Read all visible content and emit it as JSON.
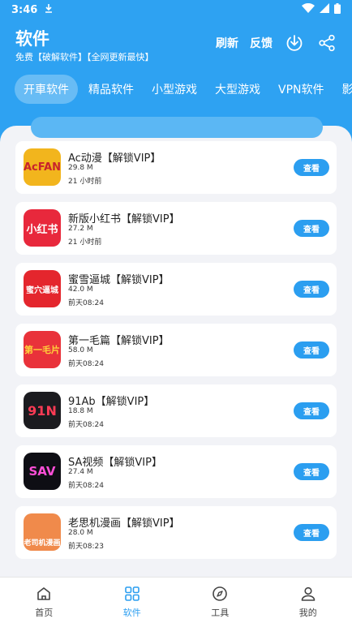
{
  "status": {
    "time": "3:46"
  },
  "header": {
    "title": "软件",
    "subtitle": "免费【破解软件】【全网更新最快】",
    "refresh_label": "刷新",
    "feedback_label": "反馈"
  },
  "tabs": [
    {
      "label": "开車软件",
      "active": true
    },
    {
      "label": "精品软件"
    },
    {
      "label": "小型游戏"
    },
    {
      "label": "大型游戏"
    },
    {
      "label": "VPN软件"
    },
    {
      "label": "影视软件"
    }
  ],
  "apps": [
    {
      "name": "Ac动漫【解锁VIP】",
      "size": "29.8 M",
      "time": "21 小时前",
      "icon_text": "AcFAN",
      "icon_color": "#f2b51d",
      "button": "查看"
    },
    {
      "name": "新版小红书【解锁VIP】",
      "size": "27.2 M",
      "time": "21 小时前",
      "icon_text": "小红书",
      "icon_color": "#e8283c",
      "button": "查看"
    },
    {
      "name": "蜜雪逼城【解锁VIP】",
      "size": "42.0 M",
      "time": "前天08:24",
      "icon_text": "蜜穴逼城",
      "icon_color": "#e4262d",
      "button": "查看"
    },
    {
      "name": "第一毛篇【解锁VIP】",
      "size": "58.0 M",
      "time": "前天08:24",
      "icon_text": "第一毛片",
      "icon_color": "#e9323a",
      "button": "查看"
    },
    {
      "name": "91Ab【解锁VIP】",
      "size": "18.8 M",
      "time": "前天08:24",
      "icon_text": "91N",
      "icon_color": "#1b1b1f",
      "button": "查看"
    },
    {
      "name": "SA视频【解锁VIP】",
      "size": "27.4 M",
      "time": "前天08:24",
      "icon_text": "SAV",
      "icon_color": "#0e0e14",
      "button": "查看"
    },
    {
      "name": "老思机漫画【解锁VIP】",
      "size": "28.0 M",
      "time": "前天08:23",
      "icon_text": "老司机漫画",
      "icon_color": "#f08a4b",
      "button": "查看"
    }
  ],
  "nav": [
    {
      "label": "首页",
      "icon": "home-icon"
    },
    {
      "label": "软件",
      "icon": "grid-icon",
      "active": true
    },
    {
      "label": "工具",
      "icon": "compass-icon"
    },
    {
      "label": "我的",
      "icon": "user-icon"
    }
  ],
  "colors": {
    "accent": "#2ea2f2",
    "button": "#2b9ef0",
    "background": "#f2f3f7"
  }
}
